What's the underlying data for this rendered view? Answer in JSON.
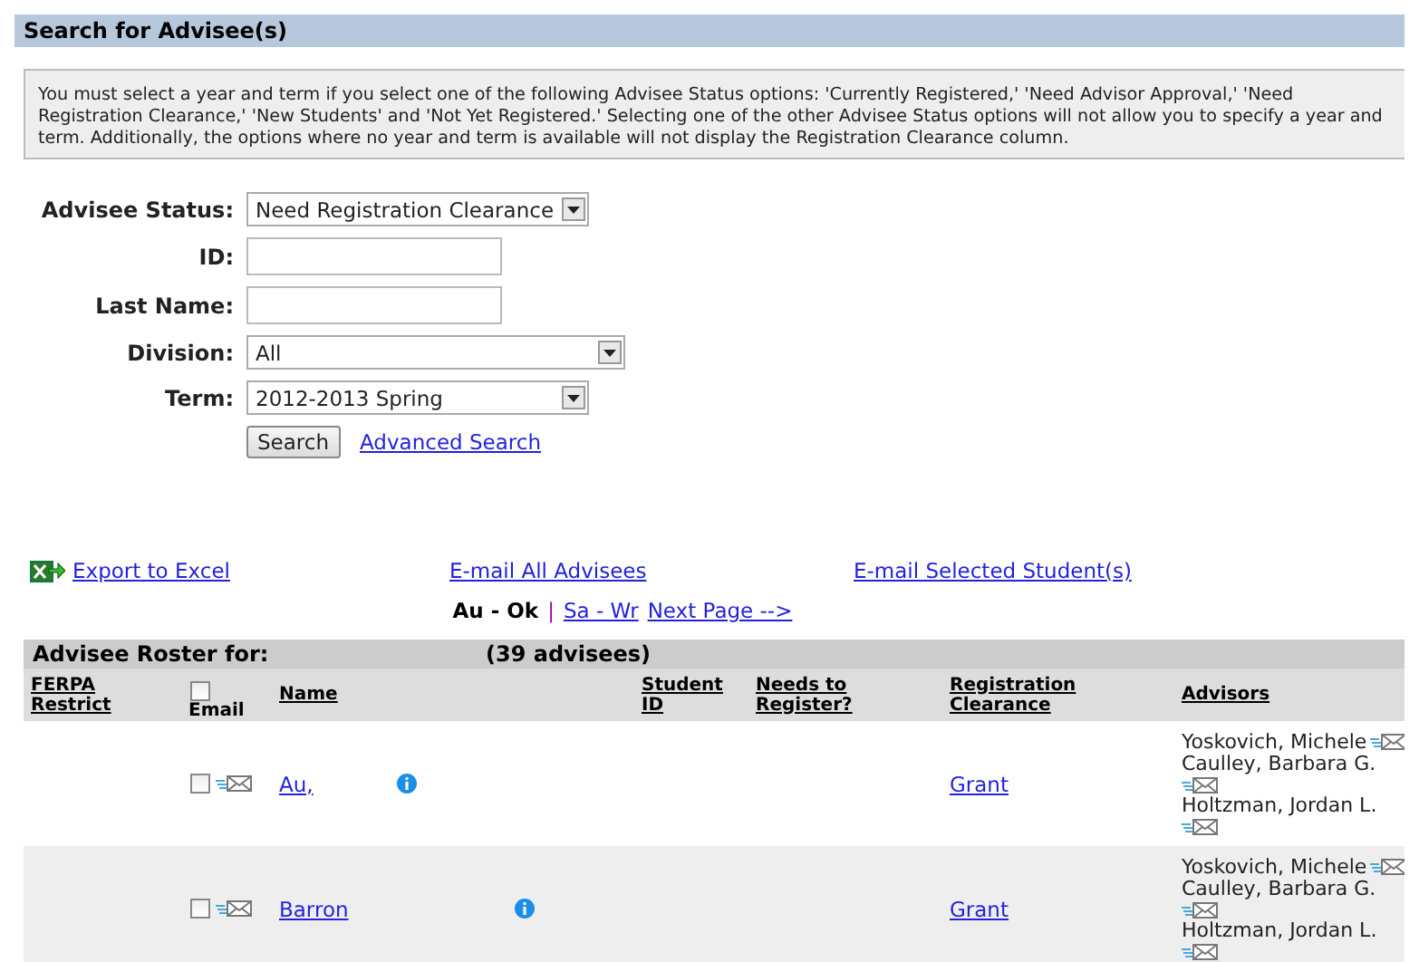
{
  "header": {
    "title": "Search for Advisee(s)"
  },
  "notice": "You must select a year and term if you select one of the following Advisee Status options: 'Currently Registered,' 'Need Advisor Approval,' 'Need Registration Clearance,' 'New Students' and 'Not Yet Registered.' Selecting one of the other Advisee Status options will not allow you to specify a year and term. Additionally, the options where no year and term is available will not display the Registration Clearance column.",
  "form": {
    "fields": [
      {
        "label": "Advisee Status:",
        "kind": "select",
        "value": "Need Registration Clearance"
      },
      {
        "label": "ID:",
        "kind": "text"
      },
      {
        "label": "Last Name:",
        "kind": "text"
      },
      {
        "label": "Division:",
        "kind": "select",
        "value": "All"
      },
      {
        "label": "Term:",
        "kind": "select",
        "value": "2012-2013 Spring"
      }
    ],
    "search_button": "Search",
    "advanced_link": "Advanced Search"
  },
  "actions": {
    "export": "Export to Excel",
    "email_all": "E-mail All Advisees",
    "email_selected": "E-mail Selected Student(s)"
  },
  "pager": {
    "separator": "|",
    "pages": [
      {
        "label": "Au - Ok",
        "selected": true
      },
      {
        "label": "Sa - Wr",
        "selected": false
      },
      {
        "label": "Next Page -->",
        "selected": false
      }
    ]
  },
  "roster": {
    "title": "Advisee Roster for:",
    "count": "(39 advisees)",
    "email_all_checked": false,
    "columns": [
      "FERPA Restrict",
      "Email",
      "Name",
      "Student ID",
      "Needs to Register?",
      "Registration Clearance",
      "Advisors"
    ],
    "rows": [
      {
        "checked": false,
        "name": "Au,",
        "clearance": "Grant",
        "advisors": [
          "Yoskovich, Michele",
          "Caulley, Barbara G.",
          "Holtzman, Jordan L."
        ]
      },
      {
        "checked": false,
        "name": "Barron",
        "clearance": "Grant",
        "advisors": [
          "Yoskovich, Michele",
          "Caulley, Barbara G.",
          "Holtzman, Jordan L."
        ]
      }
    ]
  }
}
